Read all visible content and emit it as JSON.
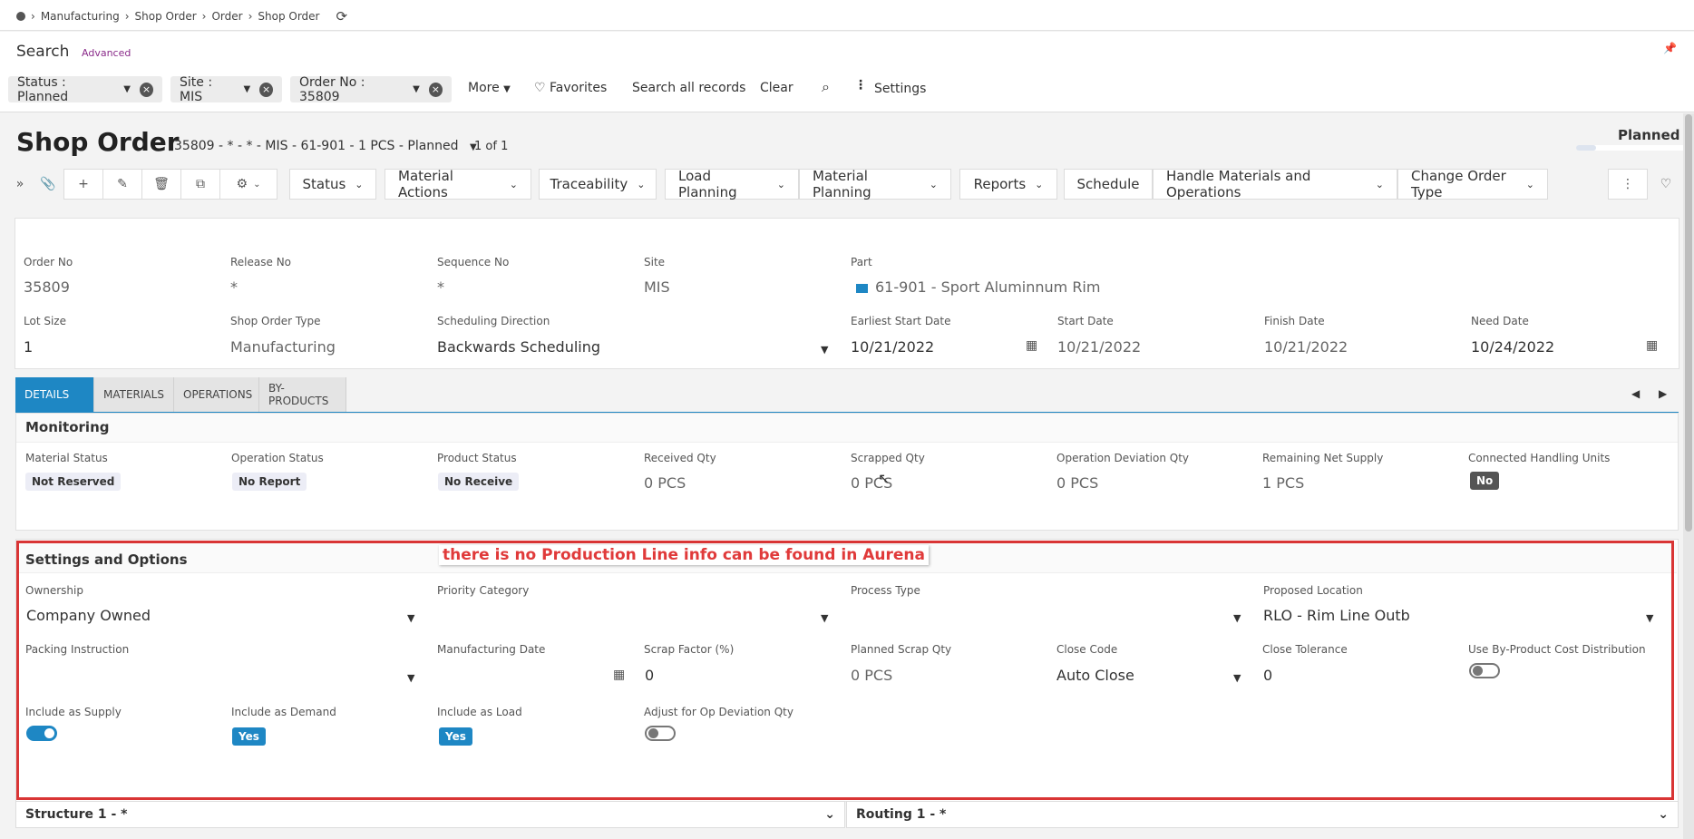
{
  "breadcrumb": {
    "items": [
      "Manufacturing",
      "Shop Order",
      "Order",
      "Shop Order"
    ]
  },
  "search": {
    "title": "Search",
    "advanced": "Advanced",
    "chips": [
      "Status : Planned",
      "Site : MIS",
      "Order No : 35809"
    ],
    "more": "More",
    "favorites": "Favorites",
    "search_all": "Search all records",
    "clear": "Clear",
    "settings": "Settings"
  },
  "header": {
    "title": "Shop Order",
    "subtitle": "35809 - * - * - MIS - 61-901 - 1 PCS - Planned",
    "count": "1 of 1",
    "status": "Planned"
  },
  "toolbar": {
    "status": "Status",
    "material_actions": "Material Actions",
    "traceability": "Traceability",
    "load_planning": "Load Planning",
    "material_planning": "Material Planning",
    "reports": "Reports",
    "schedule": "Schedule",
    "handle": "Handle Materials and Operations",
    "change_type": "Change Order Type"
  },
  "form": {
    "order_no_label": "Order No",
    "order_no": "35809",
    "release_no_label": "Release No",
    "release_no": "*",
    "sequence_no_label": "Sequence No",
    "sequence_no": "*",
    "site_label": "Site",
    "site": "MIS",
    "part_label": "Part",
    "part": "61-901 - Sport Aluminnum Rim",
    "lot_size_label": "Lot Size",
    "lot_size": "1",
    "type_label": "Shop Order Type",
    "type": "Manufacturing",
    "sched_dir_label": "Scheduling Direction",
    "sched_dir": "Backwards Scheduling",
    "earliest_start_label": "Earliest Start Date",
    "earliest_start": "10/21/2022",
    "start_label": "Start Date",
    "start": "10/21/2022",
    "finish_label": "Finish Date",
    "finish": "10/21/2022",
    "need_label": "Need Date",
    "need": "10/24/2022"
  },
  "tabs": [
    "DETAILS",
    "MATERIALS",
    "OPERATIONS",
    "BY-PRODUCTS"
  ],
  "monitoring": {
    "title": "Monitoring",
    "material_status_label": "Material Status",
    "material_status": "Not Reserved",
    "operation_status_label": "Operation Status",
    "operation_status": "No Report",
    "product_status_label": "Product Status",
    "product_status": "No Receive",
    "received_label": "Received Qty",
    "received": "0 PCS",
    "scrapped_label": "Scrapped Qty",
    "scrapped": "0 PCS",
    "op_dev_label": "Operation Deviation Qty",
    "op_dev": "0 PCS",
    "remaining_label": "Remaining Net Supply",
    "remaining": "1 PCS",
    "handling_label": "Connected Handling Units",
    "handling": "No"
  },
  "settings": {
    "title": "Settings and Options",
    "annotation": "there is no Production Line info can be found in Aurena",
    "ownership_label": "Ownership",
    "ownership": "Company Owned",
    "priority_label": "Priority Category",
    "process_label": "Process Type",
    "location_label": "Proposed Location",
    "location": "RLO - Rim Line Outb",
    "packing_label": "Packing Instruction",
    "mfg_date_label": "Manufacturing Date",
    "scrap_factor_label": "Scrap Factor (%)",
    "scrap_factor": "0",
    "planned_scrap_label": "Planned Scrap Qty",
    "planned_scrap": "0 PCS",
    "close_code_label": "Close Code",
    "close_code": "Auto Close",
    "close_tol_label": "Close Tolerance",
    "close_tol": "0",
    "byproduct_label": "Use By-Product Cost Distribution",
    "supply_label": "Include as Supply",
    "demand_label": "Include as Demand",
    "demand": "Yes",
    "load_label": "Include as Load",
    "load": "Yes",
    "adjust_label": "Adjust for Op Deviation Qty"
  },
  "bottom": {
    "structure": "Structure 1 - *",
    "routing": "Routing 1 - *"
  }
}
